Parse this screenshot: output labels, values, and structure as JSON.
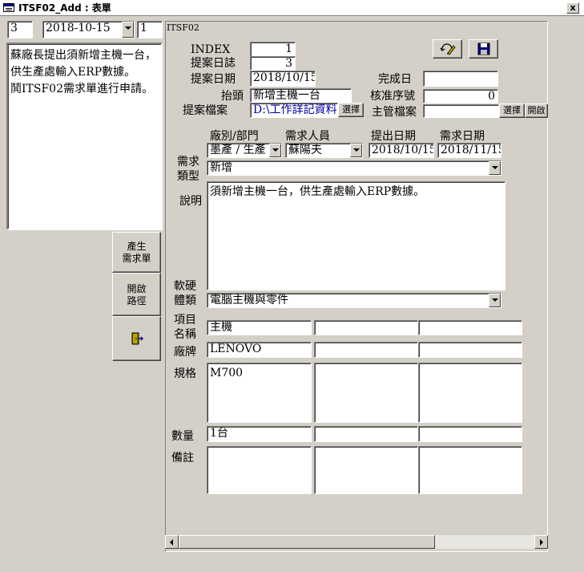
{
  "window": {
    "title": "ITSF02_Add : 表單",
    "close": "x"
  },
  "left": {
    "record_no": "3",
    "date": "2018-10-15",
    "seq": "1",
    "memo": "蘇廠長提出須新增主機一台，供生產處輸入ERP數據。\n鬨ITSF02需求單進行申請。",
    "btn_generate": "產生\n需求單",
    "btn_open_path": "開啟\n路徑"
  },
  "form": {
    "section_label": "ITSF02",
    "index_label": "INDEX",
    "index_value": "1",
    "log_label": "提案日誌",
    "log_value": "3",
    "date_label": "提案日期",
    "date_value": "2018/10/15",
    "done_label": "完成日",
    "done_value": "",
    "subject_label": "抬頭",
    "subject_value": "新增主機一台",
    "approval_label": "核准序號",
    "approval_value": "0",
    "file_label": "提案檔案",
    "file_value": "D:\\工作詳記資料",
    "choose": "選擇",
    "open": "開啟",
    "manager_file_label": "主管檔案",
    "manager_file_value": "",
    "col_dept": "廠別/部門",
    "col_requester": "需求人員",
    "col_submit_date": "提出日期",
    "col_need_date": "需求日期",
    "need_label": "需求\n類型",
    "dept_value": "墨產 / 生產",
    "requester_value": "蘇陽夫",
    "submit_date_value": "2018/10/15",
    "need_date_value": "2018/11/15",
    "type_value": "新增",
    "desc_label": "說明",
    "desc_value": "須新增主機一台，供生產處輸入ERP數據。",
    "hw_label": "軟硬\n體類",
    "hw_value": "電腦主機與零件",
    "item_label": "項目\n名稱",
    "item_value": "主機",
    "brand_label": "廠牌",
    "brand_value": "LENOVO",
    "spec_label": "規格",
    "spec_value": "M700",
    "qty_label": "數量",
    "qty_value": "1台",
    "note_label": "備註"
  }
}
